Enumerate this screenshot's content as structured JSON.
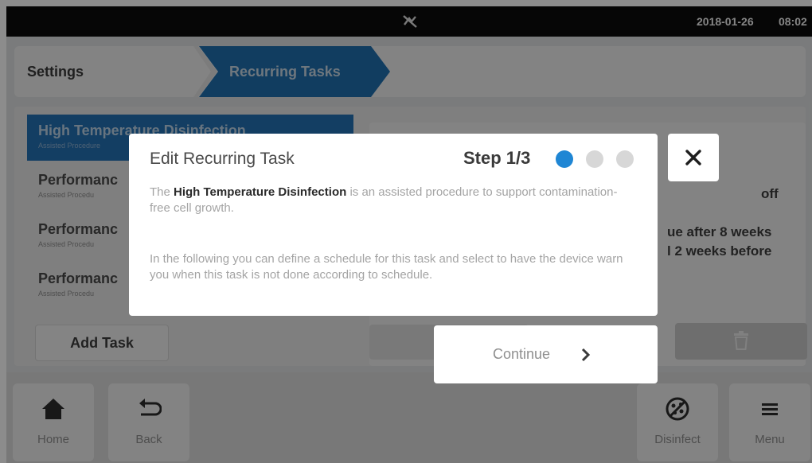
{
  "status_bar": {
    "icon": "network-off-icon",
    "date": "2018-01-26",
    "time": "08:02"
  },
  "breadcrumb": {
    "items": [
      {
        "label": "Settings"
      },
      {
        "label": "Recurring Tasks"
      }
    ],
    "active_color": "#1f6fb0"
  },
  "task_list": {
    "items": [
      {
        "title": "High Temperature Disinfection",
        "subtitle": "Assisted Procedure",
        "selected": true
      },
      {
        "title": "Performanc",
        "subtitle": "Assisted Procedu",
        "selected": false
      },
      {
        "title": "Performanc",
        "subtitle": "Assisted Procedu",
        "selected": false
      },
      {
        "title": "Performanc",
        "subtitle": "Assisted Procedu",
        "selected": false
      }
    ],
    "add_task_label": "Add Task"
  },
  "detail": {
    "warn_value": "off",
    "due_line1": "ue after 8 weeks",
    "due_line2": "l 2 weeks before"
  },
  "modal": {
    "title": "Edit Recurring Task",
    "step_label": "Step 1/3",
    "steps_total": 3,
    "current_step": 1,
    "para1_pre": "The ",
    "para1_bold": "High Temperature Disinfection",
    "para1_post": " is an assisted procedure to support contamination-free cell growth.",
    "para2": "In the following you can define a schedule for this task and select to have the device warn you when this task is not done according to schedule.",
    "continue_label": "Continue",
    "accent_color": "#1f86d4"
  },
  "bottom_nav": {
    "home_label": "Home",
    "back_label": "Back",
    "disinfect_label": "Disinfect",
    "menu_label": "Menu"
  }
}
